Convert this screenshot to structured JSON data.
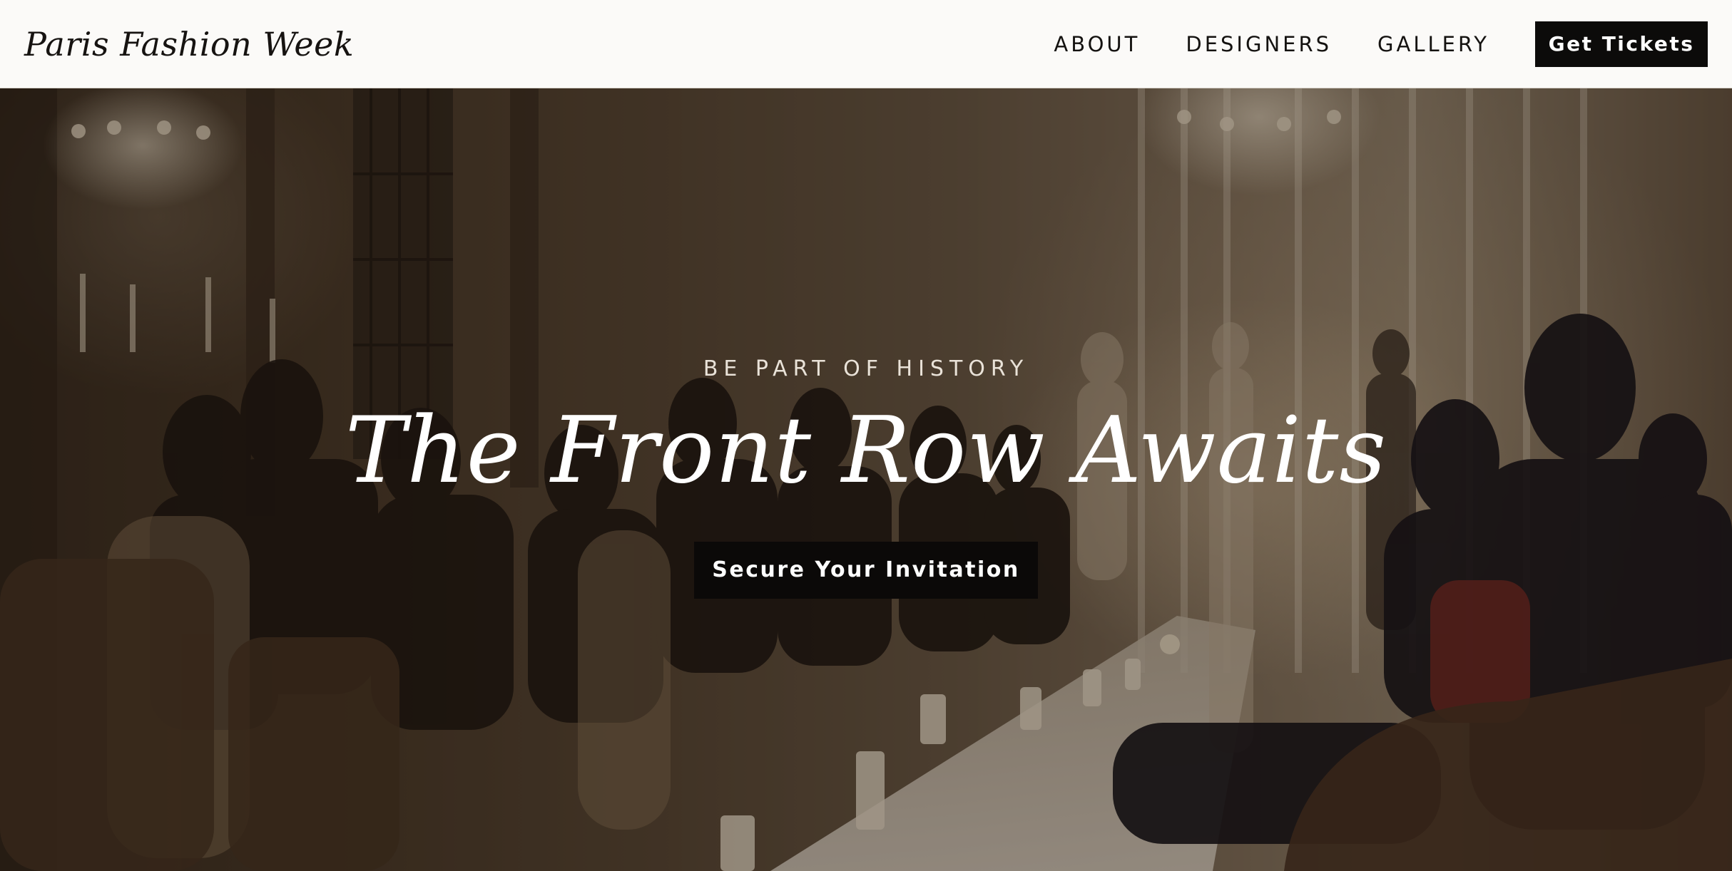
{
  "brand": {
    "name": "Paris Fashion Week"
  },
  "nav": {
    "links": [
      {
        "label": "ABOUT"
      },
      {
        "label": "DESIGNERS"
      },
      {
        "label": "GALLERY"
      }
    ],
    "cta_label": "Get Tickets"
  },
  "hero": {
    "eyebrow": "BE PART OF HISTORY",
    "headline": "The Front Row Awaits",
    "cta_label": "Secure Your Invitation",
    "background_image": "fashion-show-front-row-photo"
  },
  "colors": {
    "header_bg": "#fbfaf8",
    "button_bg": "#0c0b0a",
    "text_dark": "#141210",
    "text_light": "#ffffff"
  }
}
